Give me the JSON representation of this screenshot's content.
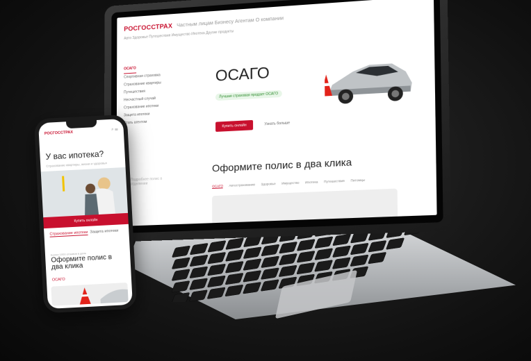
{
  "laptop": {
    "logo": "РОСГОССТРАХ",
    "top_links": "Частным лицам   Бизнесу   Агентам   О компании",
    "nav": "Авто   Здоровье   Путешествия   Имущество   Ипотека   Другие продукты",
    "sidebar": [
      "ОСАГО",
      "Спортивная страховка",
      "Страхование квартиры",
      "Путешествия",
      "Несчастный случай",
      "Страхование ипотеки",
      "Защита ипотеки",
      "Стать агентом"
    ],
    "title": "ОСАГО",
    "badge": "Лучшая страховая продает ОСАГО",
    "buy": "Купить онлайн",
    "more": "Узнать больше",
    "promo": "Подробнее полис в отделении",
    "heading2": "Оформите полис в два клика",
    "tabs": [
      "ОСАГО",
      "Автострахование",
      "Здоровье",
      "Имущество",
      "Ипотека",
      "Путешествия",
      "Питомцы"
    ]
  },
  "phone": {
    "logo": "РОСГОССТРАХ",
    "icons": "⌕ ☰",
    "heading": "У вас ипотека?",
    "sub": "Страхование квартиры, жизни и здоровья",
    "buy": "Купить онлайн",
    "tab1": "Страхование ипотеки",
    "tab2": "Защита ипотеки",
    "small": "Более 1000 отзывов в день",
    "heading2": "Оформите полис в два клика",
    "osago": "ОСАГО"
  }
}
